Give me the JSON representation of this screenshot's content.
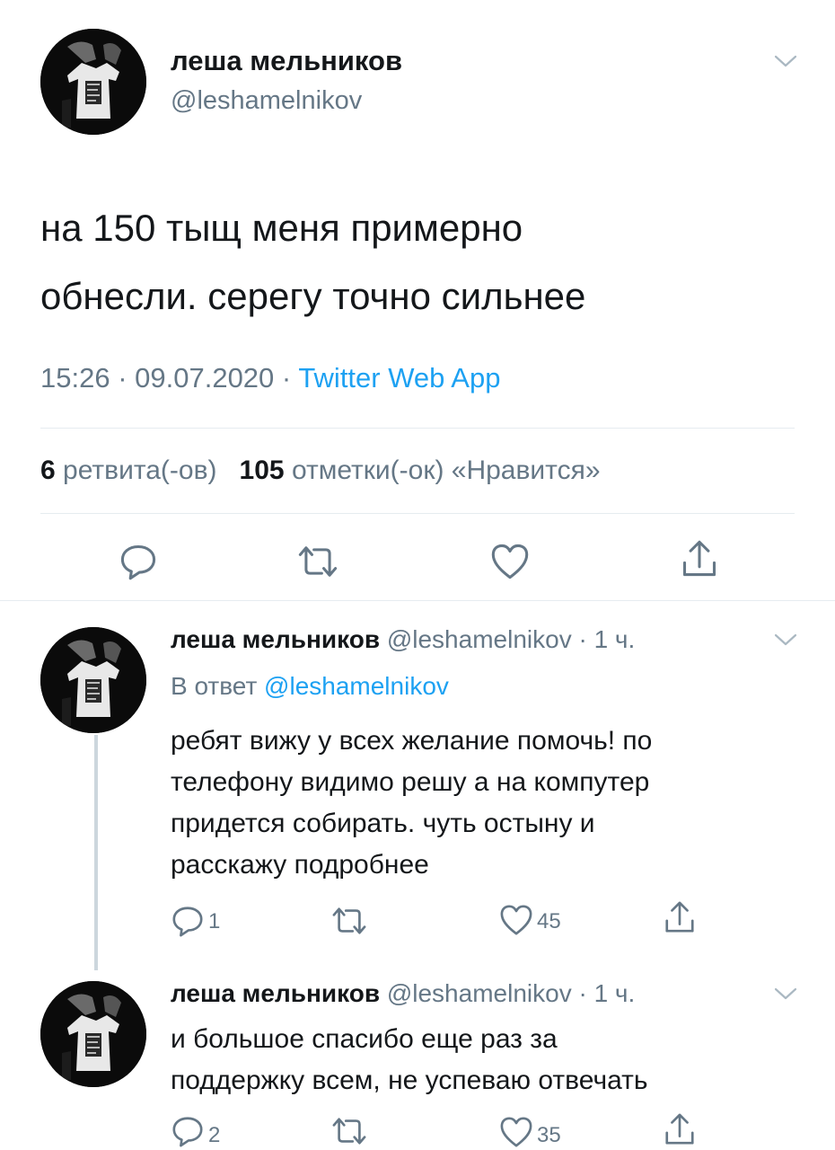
{
  "main": {
    "author_name": "леша мельников",
    "handle": "@leshamelnikov",
    "text_line1": "на 150 тыщ меня примерно",
    "text_line2": "обнесли. серегу точно сильнее",
    "time": "15:26",
    "date": "09.07.2020",
    "source": "Twitter Web App",
    "retweets_count": "6",
    "retweets_label": "ретвита(-ов)",
    "likes_count": "105",
    "likes_label": "отметки(-ок) «Нравится»"
  },
  "replies": [
    {
      "author_name": "леша мельников",
      "handle": "@leshamelnikov",
      "age": "1 ч.",
      "reply_to_label": "В ответ",
      "reply_to_handle": "@leshamelnikov",
      "text_lines": [
        "ребят вижу у всех желание помочь! по",
        "телефону видимо решу а на компутер",
        "придется собирать. чуть остыну и",
        "расскажу подробнее"
      ],
      "reply_count": "1",
      "like_count": "45"
    },
    {
      "author_name": "леша мельников",
      "handle": "@leshamelnikov",
      "age": "1 ч.",
      "text_lines": [
        "и большое спасибо еще раз за",
        "поддержку всем, не успеваю отвечать"
      ],
      "reply_count": "2",
      "like_count": "35"
    }
  ],
  "icons": {
    "reply": "reply-icon",
    "retweet": "retweet-icon",
    "like": "heart-icon",
    "share": "share-icon",
    "caret": "chevron-down-icon"
  },
  "colors": {
    "link": "#1da1f2",
    "secondary_text": "#657786",
    "primary_text": "#14171a",
    "divider": "#e6ecf0"
  }
}
